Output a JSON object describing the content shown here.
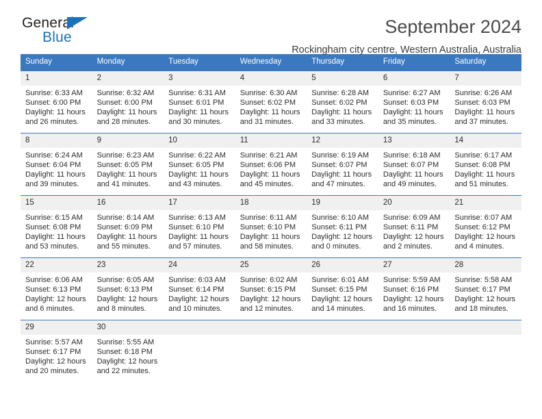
{
  "brand": {
    "name_top": "General",
    "name_bottom": "Blue",
    "accent_color": "#1a72bb"
  },
  "header": {
    "title": "September 2024",
    "subtitle": "Rockingham city centre, Western Australia, Australia"
  },
  "calendar": {
    "header_bg": "#3a79bf",
    "daynum_bg": "#f0f0f0",
    "weekdays": [
      "Sunday",
      "Monday",
      "Tuesday",
      "Wednesday",
      "Thursday",
      "Friday",
      "Saturday"
    ],
    "weeks": [
      [
        {
          "day": "1",
          "sunrise": "Sunrise: 6:33 AM",
          "sunset": "Sunset: 6:00 PM",
          "daylight": "Daylight: 11 hours and 26 minutes."
        },
        {
          "day": "2",
          "sunrise": "Sunrise: 6:32 AM",
          "sunset": "Sunset: 6:00 PM",
          "daylight": "Daylight: 11 hours and 28 minutes."
        },
        {
          "day": "3",
          "sunrise": "Sunrise: 6:31 AM",
          "sunset": "Sunset: 6:01 PM",
          "daylight": "Daylight: 11 hours and 30 minutes."
        },
        {
          "day": "4",
          "sunrise": "Sunrise: 6:30 AM",
          "sunset": "Sunset: 6:02 PM",
          "daylight": "Daylight: 11 hours and 31 minutes."
        },
        {
          "day": "5",
          "sunrise": "Sunrise: 6:28 AM",
          "sunset": "Sunset: 6:02 PM",
          "daylight": "Daylight: 11 hours and 33 minutes."
        },
        {
          "day": "6",
          "sunrise": "Sunrise: 6:27 AM",
          "sunset": "Sunset: 6:03 PM",
          "daylight": "Daylight: 11 hours and 35 minutes."
        },
        {
          "day": "7",
          "sunrise": "Sunrise: 6:26 AM",
          "sunset": "Sunset: 6:03 PM",
          "daylight": "Daylight: 11 hours and 37 minutes."
        }
      ],
      [
        {
          "day": "8",
          "sunrise": "Sunrise: 6:24 AM",
          "sunset": "Sunset: 6:04 PM",
          "daylight": "Daylight: 11 hours and 39 minutes."
        },
        {
          "day": "9",
          "sunrise": "Sunrise: 6:23 AM",
          "sunset": "Sunset: 6:05 PM",
          "daylight": "Daylight: 11 hours and 41 minutes."
        },
        {
          "day": "10",
          "sunrise": "Sunrise: 6:22 AM",
          "sunset": "Sunset: 6:05 PM",
          "daylight": "Daylight: 11 hours and 43 minutes."
        },
        {
          "day": "11",
          "sunrise": "Sunrise: 6:21 AM",
          "sunset": "Sunset: 6:06 PM",
          "daylight": "Daylight: 11 hours and 45 minutes."
        },
        {
          "day": "12",
          "sunrise": "Sunrise: 6:19 AM",
          "sunset": "Sunset: 6:07 PM",
          "daylight": "Daylight: 11 hours and 47 minutes."
        },
        {
          "day": "13",
          "sunrise": "Sunrise: 6:18 AM",
          "sunset": "Sunset: 6:07 PM",
          "daylight": "Daylight: 11 hours and 49 minutes."
        },
        {
          "day": "14",
          "sunrise": "Sunrise: 6:17 AM",
          "sunset": "Sunset: 6:08 PM",
          "daylight": "Daylight: 11 hours and 51 minutes."
        }
      ],
      [
        {
          "day": "15",
          "sunrise": "Sunrise: 6:15 AM",
          "sunset": "Sunset: 6:08 PM",
          "daylight": "Daylight: 11 hours and 53 minutes."
        },
        {
          "day": "16",
          "sunrise": "Sunrise: 6:14 AM",
          "sunset": "Sunset: 6:09 PM",
          "daylight": "Daylight: 11 hours and 55 minutes."
        },
        {
          "day": "17",
          "sunrise": "Sunrise: 6:13 AM",
          "sunset": "Sunset: 6:10 PM",
          "daylight": "Daylight: 11 hours and 57 minutes."
        },
        {
          "day": "18",
          "sunrise": "Sunrise: 6:11 AM",
          "sunset": "Sunset: 6:10 PM",
          "daylight": "Daylight: 11 hours and 58 minutes."
        },
        {
          "day": "19",
          "sunrise": "Sunrise: 6:10 AM",
          "sunset": "Sunset: 6:11 PM",
          "daylight": "Daylight: 12 hours and 0 minutes."
        },
        {
          "day": "20",
          "sunrise": "Sunrise: 6:09 AM",
          "sunset": "Sunset: 6:11 PM",
          "daylight": "Daylight: 12 hours and 2 minutes."
        },
        {
          "day": "21",
          "sunrise": "Sunrise: 6:07 AM",
          "sunset": "Sunset: 6:12 PM",
          "daylight": "Daylight: 12 hours and 4 minutes."
        }
      ],
      [
        {
          "day": "22",
          "sunrise": "Sunrise: 6:06 AM",
          "sunset": "Sunset: 6:13 PM",
          "daylight": "Daylight: 12 hours and 6 minutes."
        },
        {
          "day": "23",
          "sunrise": "Sunrise: 6:05 AM",
          "sunset": "Sunset: 6:13 PM",
          "daylight": "Daylight: 12 hours and 8 minutes."
        },
        {
          "day": "24",
          "sunrise": "Sunrise: 6:03 AM",
          "sunset": "Sunset: 6:14 PM",
          "daylight": "Daylight: 12 hours and 10 minutes."
        },
        {
          "day": "25",
          "sunrise": "Sunrise: 6:02 AM",
          "sunset": "Sunset: 6:15 PM",
          "daylight": "Daylight: 12 hours and 12 minutes."
        },
        {
          "day": "26",
          "sunrise": "Sunrise: 6:01 AM",
          "sunset": "Sunset: 6:15 PM",
          "daylight": "Daylight: 12 hours and 14 minutes."
        },
        {
          "day": "27",
          "sunrise": "Sunrise: 5:59 AM",
          "sunset": "Sunset: 6:16 PM",
          "daylight": "Daylight: 12 hours and 16 minutes."
        },
        {
          "day": "28",
          "sunrise": "Sunrise: 5:58 AM",
          "sunset": "Sunset: 6:17 PM",
          "daylight": "Daylight: 12 hours and 18 minutes."
        }
      ],
      [
        {
          "day": "29",
          "sunrise": "Sunrise: 5:57 AM",
          "sunset": "Sunset: 6:17 PM",
          "daylight": "Daylight: 12 hours and 20 minutes."
        },
        {
          "day": "30",
          "sunrise": "Sunrise: 5:55 AM",
          "sunset": "Sunset: 6:18 PM",
          "daylight": "Daylight: 12 hours and 22 minutes."
        },
        {
          "day": "",
          "sunrise": "",
          "sunset": "",
          "daylight": ""
        },
        {
          "day": "",
          "sunrise": "",
          "sunset": "",
          "daylight": ""
        },
        {
          "day": "",
          "sunrise": "",
          "sunset": "",
          "daylight": ""
        },
        {
          "day": "",
          "sunrise": "",
          "sunset": "",
          "daylight": ""
        },
        {
          "day": "",
          "sunrise": "",
          "sunset": "",
          "daylight": ""
        }
      ]
    ]
  }
}
